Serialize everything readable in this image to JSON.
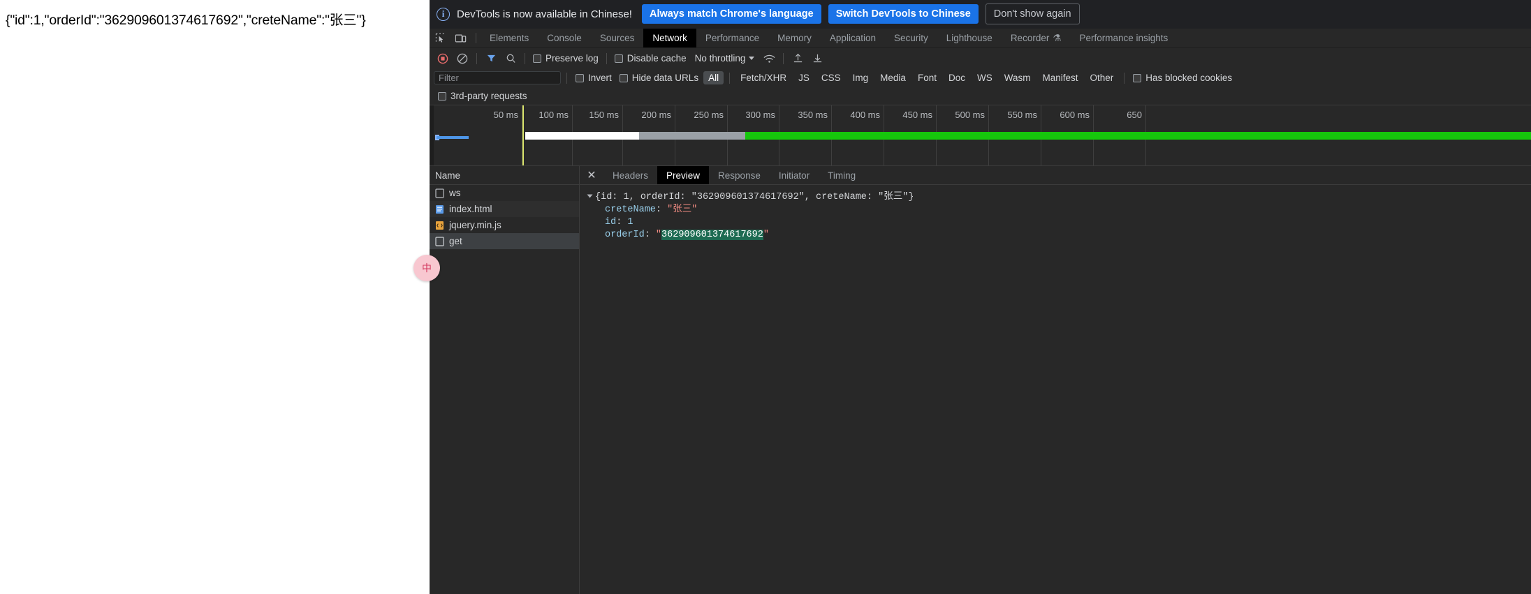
{
  "page": {
    "response_text": "{\"id\":1,\"orderId\":\"362909601374617692\",\"creteName\":\"张三\"}",
    "badge_label": "中"
  },
  "banner": {
    "icon": "info-circle-icon",
    "message": "DevTools is now available in Chinese!",
    "always_match_label": "Always match Chrome's language",
    "switch_label": "Switch DevTools to Chinese",
    "dont_show_label": "Don't show again",
    "accent_color": "#1a73e8"
  },
  "tabbar": {
    "inspect_icon": "inspect-element-icon",
    "device_icon": "device-toolbar-icon",
    "tabs": [
      {
        "label": "Elements",
        "active": false
      },
      {
        "label": "Console",
        "active": false
      },
      {
        "label": "Sources",
        "active": false
      },
      {
        "label": "Network",
        "active": true
      },
      {
        "label": "Performance",
        "active": false
      },
      {
        "label": "Memory",
        "active": false
      },
      {
        "label": "Application",
        "active": false
      },
      {
        "label": "Security",
        "active": false
      },
      {
        "label": "Lighthouse",
        "active": false
      },
      {
        "label": "Recorder",
        "active": false,
        "badge": "⚗"
      },
      {
        "label": "Performance insights",
        "active": false
      }
    ]
  },
  "network_toolbar": {
    "record_icon": "record-stop-icon",
    "clear_icon": "clear-network-icon",
    "filter_icon": "filter-funnel-icon",
    "search_icon": "search-icon",
    "preserve_log_label": "Preserve log",
    "disable_cache_label": "Disable cache",
    "throttling_label": "No throttling",
    "wifi_icon": "network-conditions-icon",
    "import_icon": "import-har-icon",
    "export_icon": "export-har-icon"
  },
  "filter_row": {
    "filter_placeholder": "Filter",
    "invert_label": "Invert",
    "hide_data_urls_label": "Hide data URLs",
    "types": [
      {
        "label": "All",
        "active": true
      },
      {
        "label": "Fetch/XHR",
        "active": false
      },
      {
        "label": "JS",
        "active": false
      },
      {
        "label": "CSS",
        "active": false
      },
      {
        "label": "Img",
        "active": false
      },
      {
        "label": "Media",
        "active": false
      },
      {
        "label": "Font",
        "active": false
      },
      {
        "label": "Doc",
        "active": false
      },
      {
        "label": "WS",
        "active": false
      },
      {
        "label": "Wasm",
        "active": false
      },
      {
        "label": "Manifest",
        "active": false
      },
      {
        "label": "Other",
        "active": false
      }
    ],
    "has_blocked_label": "Has blocked cookies",
    "third_party_label": "3rd-party requests"
  },
  "overview": {
    "ticks": [
      "50 ms",
      "100 ms",
      "150 ms",
      "200 ms",
      "250 ms",
      "300 ms",
      "350 ms",
      "400 ms",
      "450 ms",
      "500 ms",
      "550 ms",
      "600 ms",
      "650"
    ]
  },
  "requests": {
    "column_header": "Name",
    "rows": [
      {
        "name": "ws",
        "icon": "generic-doc-icon",
        "selected": false
      },
      {
        "name": "index.html",
        "icon": "document-icon",
        "selected": false
      },
      {
        "name": "jquery.min.js",
        "icon": "script-icon",
        "selected": false
      },
      {
        "name": "get",
        "icon": "generic-doc-icon",
        "selected": true
      }
    ]
  },
  "detail": {
    "close_icon": "close-icon",
    "tabs": [
      {
        "label": "Headers",
        "active": false
      },
      {
        "label": "Preview",
        "active": true
      },
      {
        "label": "Response",
        "active": false
      },
      {
        "label": "Initiator",
        "active": false
      },
      {
        "label": "Timing",
        "active": false
      }
    ],
    "preview": {
      "root_prefix": "{id: ",
      "root_id": "1",
      "root_mid": ", orderId: ",
      "root_order": "\"362909601374617692\"",
      "root_mid2": ", creteName: ",
      "root_name": "\"张三\"",
      "root_suffix": "}",
      "rows": [
        {
          "key": "creteName",
          "sep": ": ",
          "value": "\"张三\"",
          "kind": "string",
          "selected": false
        },
        {
          "key": "id",
          "sep": ": ",
          "value": "1",
          "kind": "number",
          "selected": false
        },
        {
          "key": "orderId",
          "sep": ": ",
          "value_open": "\"",
          "value": "362909601374617692",
          "value_close": "\"",
          "kind": "string",
          "selected": true
        }
      ]
    }
  }
}
